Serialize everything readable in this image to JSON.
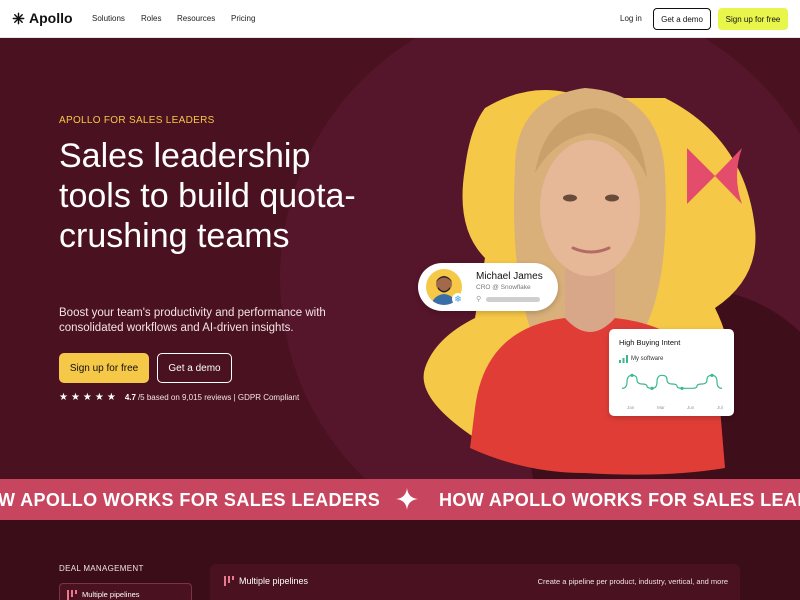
{
  "nav": {
    "logo": "Apollo",
    "items": [
      "Solutions",
      "Roles",
      "Resources",
      "Pricing"
    ],
    "login": "Log in",
    "demo": "Get a demo",
    "signup": "Sign up for free"
  },
  "hero": {
    "eyebrow": "APOLLO FOR SALES LEADERS",
    "headline": "Sales leadership tools to build quota-crushing teams",
    "subtext": "Boost your team's productivity and performance with consolidated workflows and AI-driven insights.",
    "signup": "Sign up for free",
    "demo": "Get a demo",
    "stars": "★★★★★",
    "rating_value": "4.7",
    "rating_rest": "/5 based on 9,015 reviews | GDPR Compliant"
  },
  "person_card": {
    "name": "Michael James",
    "role": "CRO @ Snowflake"
  },
  "intent_card": {
    "title": "High Buying Intent",
    "label": "My software",
    "months": [
      "Jan",
      "Mar",
      "Jun",
      "Jul"
    ],
    "values": [
      2,
      5,
      3,
      2,
      5,
      3,
      2,
      2,
      3,
      5,
      2
    ]
  },
  "marquee": {
    "left": "W APOLLO WORKS FOR SALES LEADERS",
    "right": "HOW APOLLO WORKS FOR SALES LEAD"
  },
  "deal": {
    "section_label": "DEAL MANAGEMENT",
    "tab_label": "Multiple pipelines",
    "panel_title": "Multiple pipelines",
    "panel_desc": "Create a pipeline per product, industry, vertical, and more"
  },
  "colors": {
    "hero_bg": "#4a1120",
    "accent_yellow": "#f6c847",
    "nav_signup": "#e8f54a",
    "marquee": "#c7455f"
  }
}
